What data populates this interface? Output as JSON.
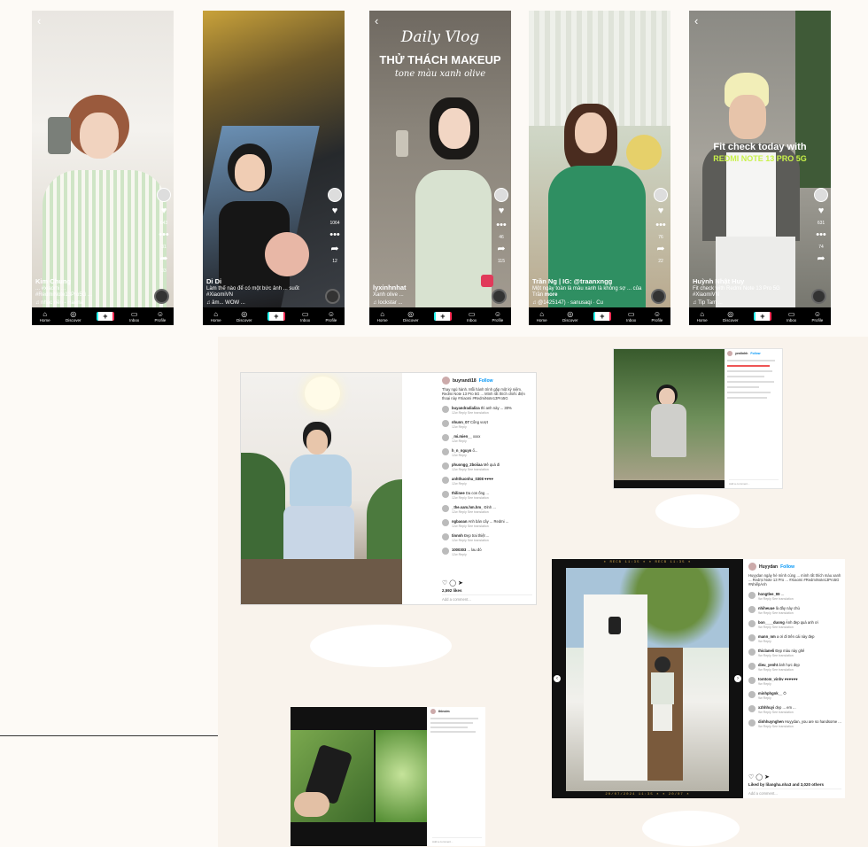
{
  "tiktok": [
    {
      "user": "Kim Chung",
      "desc": "... #xiaomi ...\n#RedmiNote13Pro5G ...",
      "music": "nhạc nền - Haena",
      "likes": "643",
      "comments": "31",
      "saves": "",
      "shares": "33"
    },
    {
      "user": "Di Di",
      "desc": "Làm thế nào để có một bức ảnh ... suốt #XiaomiVN",
      "music": "âm... WOW ...",
      "likes": "1064",
      "comments": "",
      "saves": "",
      "shares": "12"
    },
    {
      "user": "lyxinhnhat",
      "desc": "Xanh olive ...",
      "music": "lockstar ...",
      "likes": "",
      "comments": "46",
      "saves": "",
      "shares": "115",
      "title": "Daily Vlog",
      "title2": "THỬ THÁCH MAKEUP",
      "title3": "tone màu xanh olive"
    },
    {
      "user": "Trần Ng | IG: @traanxngg",
      "desc": "Một ngày toàn là màu xanh là không sợ ... của Trần",
      "music": "@1425147) · sanusaqi · Cu",
      "likes": "",
      "comments": "76",
      "saves": "",
      "shares": "22",
      "more": "more"
    },
    {
      "user": "Huỳnh Nhật Huy",
      "desc": "Fit check with Redmi Note 13 Pro 5G\n#XiaomiVN",
      "music": "Tip Tam ...",
      "likes": "631",
      "comments": "74",
      "saves": "",
      "shares": "",
      "title": "Fit check today with",
      "title2": "REDMI NOTE 13 PRO 5G"
    }
  ],
  "nav": {
    "home": "Home",
    "discover": "Discover",
    "inbox": "Inbox",
    "profile": "Profile",
    "back": "‹"
  },
  "ig_main": {
    "user": "buyrandi18",
    "follow": "Follow",
    "caption": "Thay ngủ hành. Mỗi hành trình gặp một kỷ niệm. Redmi Note 13 Pro 5G ... Mình rất thích chiếc điện thoại này #Xiaomi #RedmiNote13Pro5G",
    "comments": [
      {
        "u": "buyandradializa",
        "t": "thì anh này ... 30%",
        "m": "12w  Reply  See translation"
      },
      {
        "u": "nhunn_07",
        "t": "Cổng vượt",
        "m": "12w  Reply"
      },
      {
        "u": "_mi.mien__",
        "t": "xxxx",
        "m": "12w  Reply"
      },
      {
        "u": "h_n_nguyn",
        "t": "ổ...",
        "m": "12w  Reply"
      },
      {
        "u": "phuongg_2boiiaa",
        "t": "Mê quá đi",
        "m": "12w  Reply  See translation"
      },
      {
        "u": "anhthuonhu_0308",
        "t": "♥♥♥♥",
        "m": "12w  Reply"
      },
      {
        "u": "thilinee",
        "t": "Da con ống ...",
        "m": "12w  Reply  See translation"
      },
      {
        "u": "_the.sam.hm.hm_",
        "t": "Đỉnh ...",
        "m": "12w  Reply  See translation"
      },
      {
        "u": "ngbaoan",
        "t": "Anh bán cây ... Redmi ...",
        "m": "12w  Reply  See translation"
      },
      {
        "u": "tinnnh",
        "t": "Đẹp trai thiệt ...",
        "m": "12w  Reply  See translation"
      },
      {
        "u": "1000303",
        "t": "... lau đó",
        "m": "12w  Reply"
      }
    ],
    "likes": "2,592 likes",
    "add": "Add a comment..."
  },
  "ig_right_top": {
    "user": "yenlinhh",
    "follow": "Follow",
    "likes": "",
    "add": "Add a comment..."
  },
  "ig_big": {
    "user": "Huyydan",
    "follow": "Follow",
    "caption": "Huyydan ngày hè mình cùng ... mình rất thích màu xanh ... Redmi Note 13 Pro ... #Xiaomi #RedmiNote13Pro5G #NhiếpẢnh",
    "comments": [
      {
        "u": "hongtlee_99",
        "t": "...",
        "m": "9w  Reply  See translation"
      },
      {
        "u": "nhiheuue",
        "t": "là đây này chú",
        "m": "9w  Reply  See translation"
      },
      {
        "u": "bon____duong",
        "t": "Ảnh đẹp quá anh ơi",
        "m": "9w  Reply  See translation"
      },
      {
        "u": "mann_nm",
        "t": "a ơi đi trên cái này đẹp",
        "m": "9w  Reply"
      },
      {
        "u": "thiclaneli",
        "t": "Đẹp màu này ghê",
        "m": "9w  Reply  See translation"
      },
      {
        "u": "dieu_yenht",
        "t": "ảnh hực đẹp",
        "m": "9w  Reply  See translation"
      },
      {
        "u": "tomtom_vinhv",
        "t": "♥♥♥♥♥♥",
        "m": "9w  Reply"
      },
      {
        "u": "minhphgnk__",
        "t": "Ô",
        "m": "9w  Reply"
      },
      {
        "u": "xzhhhuyi",
        "t": "đẹp ... em ...",
        "m": "9w  Reply  See translation"
      },
      {
        "u": "dinhhuynghen",
        "t": "Huyydan, you are so handsome ...",
        "m": "9w  Reply  See translation"
      }
    ],
    "likes": "Liked by lilangha.nha3 and 3,020 others",
    "add": "Add a comment..."
  },
  "ig_bottom": {
    "user": "thinoim",
    "follow": "",
    "likes": "",
    "add": "Add a comment..."
  },
  "film_code": "✶ RECB 11:35 ✶ ✶ RECB 11:35 ✶",
  "film_code_bottom": "20/07/2024 11:35  ✶  ✶ 20/07 ✶"
}
